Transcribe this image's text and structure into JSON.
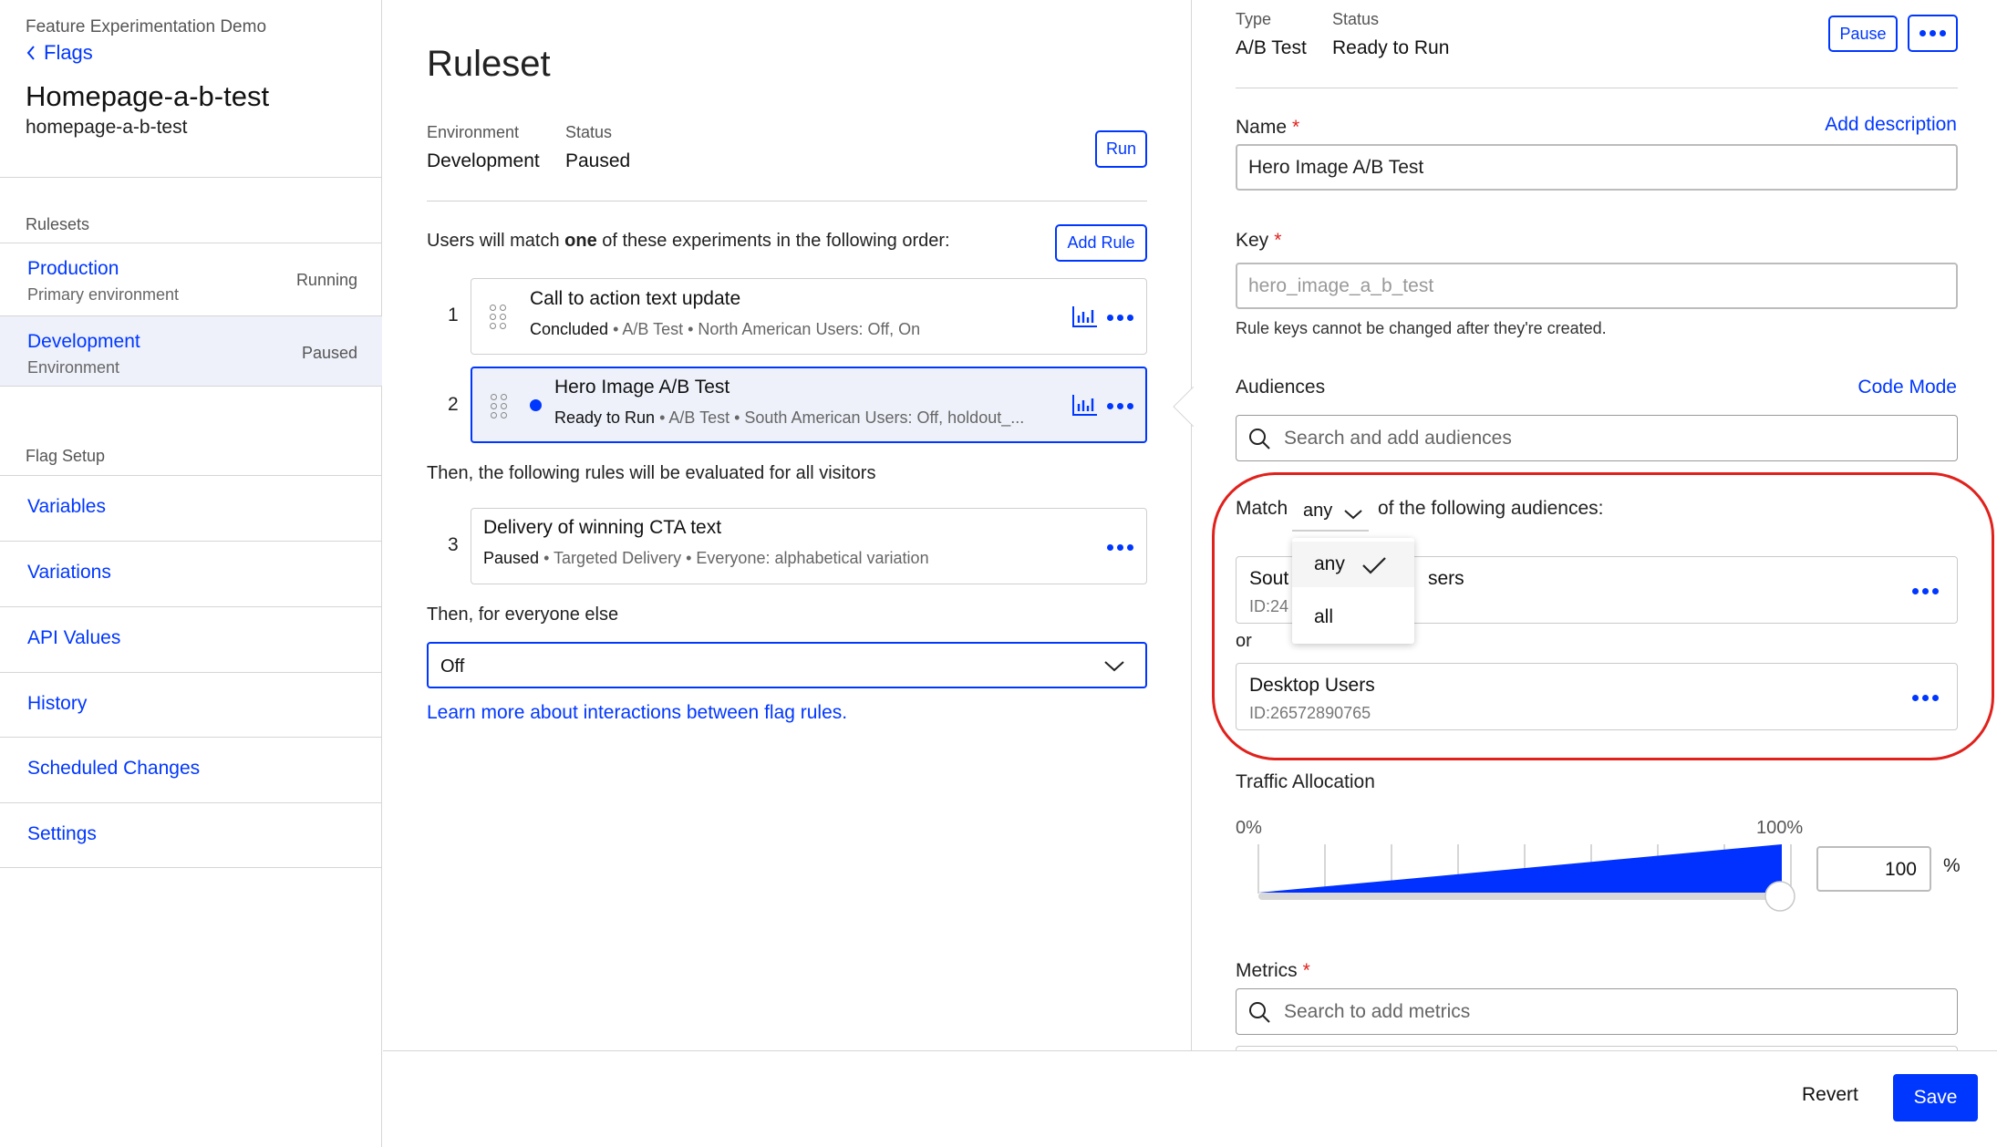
{
  "sidebar": {
    "project_name": "Feature Experimentation Demo",
    "back_label": "Flags",
    "flag_title": "Homepage-a-b-test",
    "flag_key": "homepage-a-b-test",
    "rulesets_label": "Rulesets",
    "environments": [
      {
        "name": "Production",
        "sub": "Primary environment",
        "status": "Running"
      },
      {
        "name": "Development",
        "sub": "Environment",
        "status": "Paused"
      }
    ],
    "flag_setup_label": "Flag Setup",
    "nav": [
      "Variables",
      "Variations",
      "API Values",
      "History",
      "Scheduled Changes",
      "Settings"
    ]
  },
  "ruleset": {
    "title": "Ruleset",
    "environment_label": "Environment",
    "environment_value": "Development",
    "status_label": "Status",
    "status_value": "Paused",
    "run_label": "Run",
    "match_text_pre": "Users will match ",
    "match_text_bold": "one",
    "match_text_post": " of these experiments in the following order:",
    "add_rule_label": "Add Rule",
    "rules": [
      {
        "num": "1",
        "title": "Call to action text update",
        "status": "Concluded",
        "type": "A/B Test",
        "detail": "North American Users: Off, On"
      },
      {
        "num": "2",
        "title": "Hero Image A/B Test",
        "status": "Ready to Run",
        "type": "A/B Test",
        "detail": "South American Users: Off, holdout_..."
      },
      {
        "num": "3",
        "title": "Delivery of winning CTA text",
        "status": "Paused",
        "type": "Targeted Delivery",
        "detail": "Everyone: alphabetical variation"
      }
    ],
    "then_all_text": "Then, the following rules will be evaluated for all visitors",
    "then_everyone_text": "Then, for everyone else",
    "everyone_else_value": "Off",
    "learn_more": "Learn more about interactions between flag rules."
  },
  "detail": {
    "type_label": "Type",
    "type_value": "A/B Test",
    "status_label": "Status",
    "status_value": "Ready to Run",
    "pause_label": "Pause",
    "name_label": "Name",
    "add_description": "Add description",
    "name_value": "Hero Image A/B Test",
    "key_label": "Key",
    "key_value": "hero_image_a_b_test",
    "key_help": "Rule keys cannot be changed after they're created.",
    "audiences_label": "Audiences",
    "code_mode": "Code Mode",
    "audiences_placeholder": "Search and add audiences",
    "match_label": "Match",
    "match_value": "any",
    "match_suffix": "of the following audiences:",
    "match_options": [
      "any",
      "all"
    ],
    "audiences": [
      {
        "name_start": "Sout",
        "name_end": "sers",
        "id": "ID:24"
      },
      {
        "name": "Desktop Users",
        "id": "ID:26572890765"
      }
    ],
    "or_label": "or",
    "traffic_label": "Traffic Allocation",
    "traffic_min_label": "0%",
    "traffic_max_label": "100%",
    "traffic_value": "100",
    "traffic_unit": "%",
    "traffic_fraction": 1.0,
    "metrics_label": "Metrics",
    "metrics_placeholder": "Search to add metrics"
  },
  "footer": {
    "revert_label": "Revert",
    "save_label": "Save"
  },
  "colors": {
    "accent": "#0037ff",
    "required": "#e0211c",
    "highlight_ring": "#e0211c",
    "active_bg": "#eef1fa"
  }
}
